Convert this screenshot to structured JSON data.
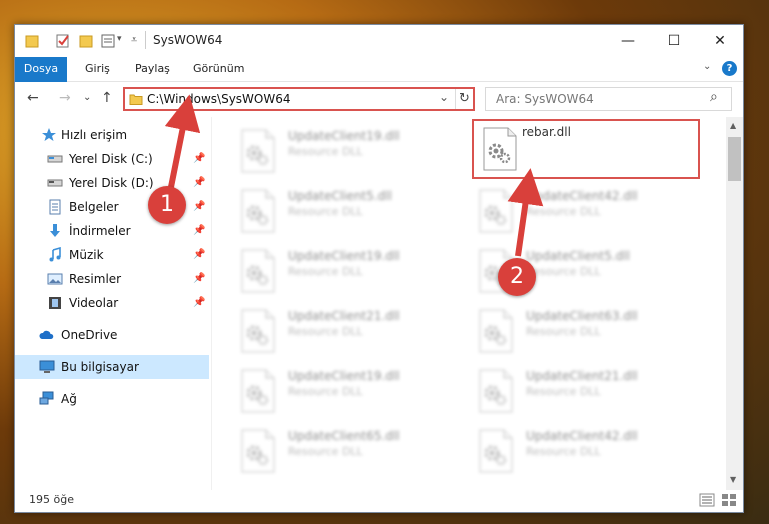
{
  "window": {
    "title": "SysWOW64",
    "minimize": "—",
    "maximize": "☐",
    "close": "✕"
  },
  "ribbon": {
    "tabs": [
      "Dosya",
      "Giriş",
      "Paylaş",
      "Görünüm"
    ],
    "expand": "⌄",
    "help": "?"
  },
  "nav": {
    "back": "←",
    "forward": "→",
    "recent": "⌄",
    "up": "↑",
    "address": "C:\\Windows\\SysWOW64",
    "address_dropdown": "⌄",
    "refresh": "↻",
    "search_placeholder": "Ara: SysWOW64",
    "search_icon": "⌕"
  },
  "sidebar": {
    "items": [
      {
        "label": "Hızlı erişim",
        "icon": "star-icon",
        "pinned": false
      },
      {
        "label": "Yerel Disk (C:)",
        "icon": "drive-icon",
        "pinned": true
      },
      {
        "label": "Yerel Disk (D:)",
        "icon": "drive-icon",
        "pinned": true
      },
      {
        "label": "Belgeler",
        "icon": "documents-icon",
        "pinned": true
      },
      {
        "label": "İndirmeler",
        "icon": "download-icon",
        "pinned": true
      },
      {
        "label": "Müzik",
        "icon": "music-icon",
        "pinned": true
      },
      {
        "label": "Resimler",
        "icon": "pictures-icon",
        "pinned": true
      },
      {
        "label": "Videolar",
        "icon": "videos-icon",
        "pinned": true
      },
      {
        "label": "OneDrive",
        "icon": "cloud-icon",
        "pinned": false
      },
      {
        "label": "Bu bilgisayar",
        "icon": "computer-icon",
        "pinned": false
      },
      {
        "label": "Ağ",
        "icon": "network-icon",
        "pinned": false
      }
    ],
    "pin_glyph": "📌"
  },
  "files": {
    "left_column": [
      {
        "name": "UpdateClient19.dll",
        "type": "Resource DLL"
      },
      {
        "name": "UpdateClient5.dll",
        "type": "Resource DLL"
      },
      {
        "name": "UpdateClient19.dll",
        "type": "Resource DLL"
      },
      {
        "name": "UpdateClient21.dll",
        "type": "Resource DLL"
      },
      {
        "name": "UpdateClient19.dll",
        "type": "Resource DLL"
      },
      {
        "name": "UpdateClient65.dll",
        "type": "Resource DLL"
      }
    ],
    "right_column": [
      {
        "name": "rebar.dll",
        "type": ""
      },
      {
        "name": "UpdateClient42.dll",
        "type": "Resource DLL"
      },
      {
        "name": "UpdateClient5.dll",
        "type": "Resource DLL"
      },
      {
        "name": "UpdateClient63.dll",
        "type": "Resource DLL"
      },
      {
        "name": "UpdateClient21.dll",
        "type": "Resource DLL"
      },
      {
        "name": "UpdateClient42.dll",
        "type": "Resource DLL"
      }
    ]
  },
  "status": {
    "count": "195 öğe"
  },
  "annotations": {
    "badge1": "1",
    "badge2": "2",
    "color": "#d9403b"
  },
  "colors": {
    "accent": "#1979ca",
    "highlight_border": "#d9534f",
    "selected_bg": "#cce8ff"
  }
}
